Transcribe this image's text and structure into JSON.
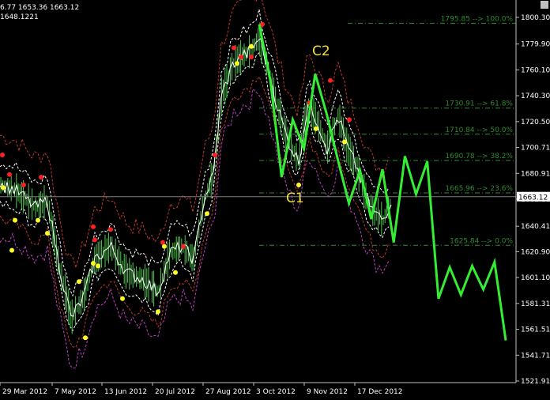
{
  "header": {
    "ohlc_line": "6.77 1653.36 1663.12",
    "second_line": "1648.1221"
  },
  "chart_data": {
    "type": "line",
    "y_axis": {
      "min": 1521.91,
      "max": 1800.3,
      "ticks": [
        "1800.30",
        "1779.90",
        "1760.10",
        "1740.30",
        "1720.50",
        "1700.71",
        "1680.91",
        "1661.11",
        "1640.41",
        "1620.90",
        "1601.10",
        "1581.31",
        "1561.51",
        "1541.71",
        "1521.91"
      ]
    },
    "x_axis": {
      "ticks": [
        "29 Mar 2012",
        "7 May 2012",
        "13 Jun 2012",
        "20 Jul 2012",
        "27 Aug 2012",
        "3 Oct 2012",
        "9 Nov 2012",
        "17 Dec 2012"
      ]
    },
    "current_price": "1663.12",
    "fib_levels": [
      {
        "price": 1795.85,
        "label": "1795.85 --> 100.0%"
      },
      {
        "price": 1730.91,
        "label": "1730.91 --> 61.8%"
      },
      {
        "price": 1710.84,
        "label": "1710.84 --> 50.0%"
      },
      {
        "price": 1690.78,
        "label": "1690.78 --> 38.2%"
      },
      {
        "price": 1665.96,
        "label": "1665.96 --> 23.6%"
      },
      {
        "price": 1625.84,
        "label": "1625.84 --> 0.0%"
      }
    ],
    "annotations": [
      {
        "text": "C1",
        "price": 1672
      },
      {
        "text": "C2",
        "price": 1783
      }
    ],
    "projection": {
      "name": "",
      "color": "#33ee33",
      "points": [
        [
          0,
          1795
        ],
        [
          1,
          1752
        ],
        [
          2,
          1678
        ],
        [
          3,
          1722
        ],
        [
          4,
          1700
        ],
        [
          5,
          1757
        ],
        [
          6,
          1727
        ],
        [
          7,
          1692
        ],
        [
          8,
          1658
        ],
        [
          9,
          1683
        ],
        [
          10,
          1646
        ],
        [
          11,
          1684
        ],
        [
          12,
          1628
        ],
        [
          13,
          1694
        ],
        [
          14,
          1665
        ],
        [
          15,
          1690
        ],
        [
          16,
          1585
        ],
        [
          17,
          1609
        ],
        [
          18,
          1588
        ],
        [
          19,
          1610
        ],
        [
          20,
          1592
        ],
        [
          21,
          1613
        ],
        [
          22,
          1553
        ]
      ]
    },
    "colors": {
      "background": "#000000",
      "bars": "#4fc84f",
      "ma_white": "#ffffff",
      "band_dashed": "#ffffff",
      "band_red": "#c0392b",
      "band_magenta": "#c040c0",
      "fractal_up": "#ff2020",
      "fractal_down": "#ffff20",
      "fib": "#2e8b2e",
      "current_line": "#808080"
    }
  }
}
